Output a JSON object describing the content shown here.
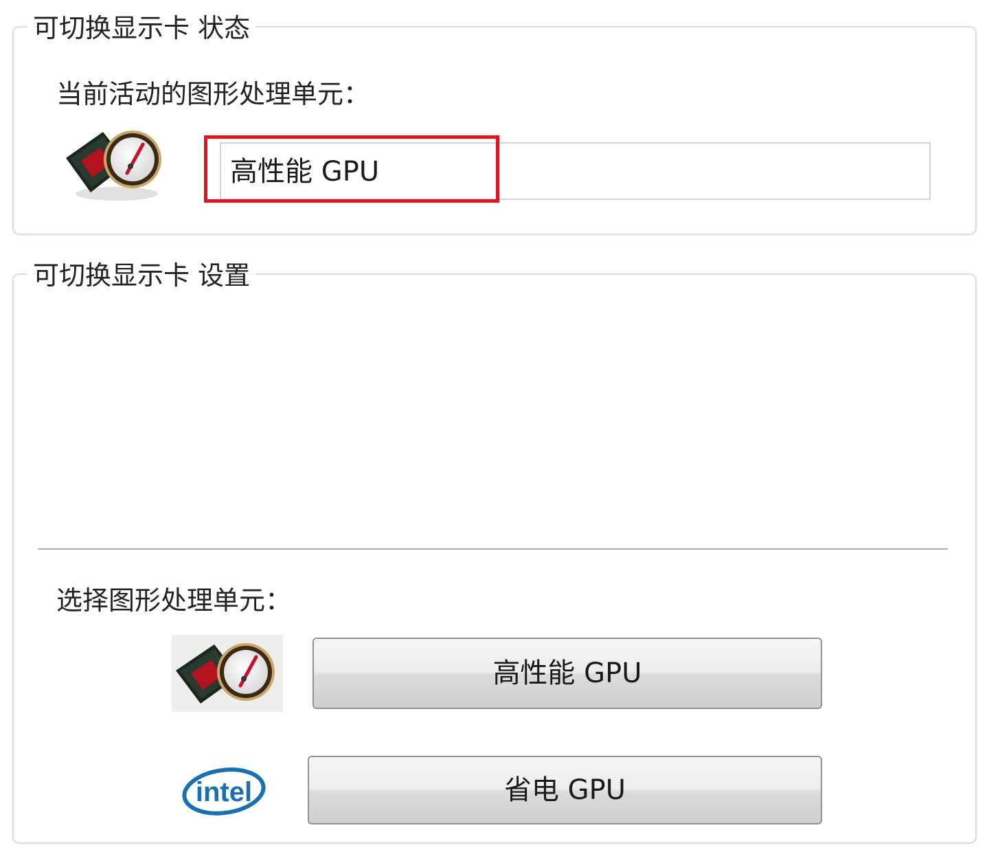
{
  "status_group": {
    "legend": "可切换显示卡 状态",
    "current_label": "当前活动的图形处理单元：",
    "current_value": "高性能 GPU"
  },
  "settings_group": {
    "legend": "可切换显示卡 设置",
    "select_label": "选择图形处理单元：",
    "high_perf_button": "高性能 GPU",
    "power_saving_button": "省电 GPU",
    "intel_logo_text": "intel"
  },
  "colors": {
    "highlight": "#e0151f",
    "amd_red": "#c8102e",
    "intel_blue": "#1a6fb0"
  },
  "icons": {
    "high_performance": "amd-gpu-speedometer-icon",
    "power_saving": "intel-logo-icon"
  }
}
